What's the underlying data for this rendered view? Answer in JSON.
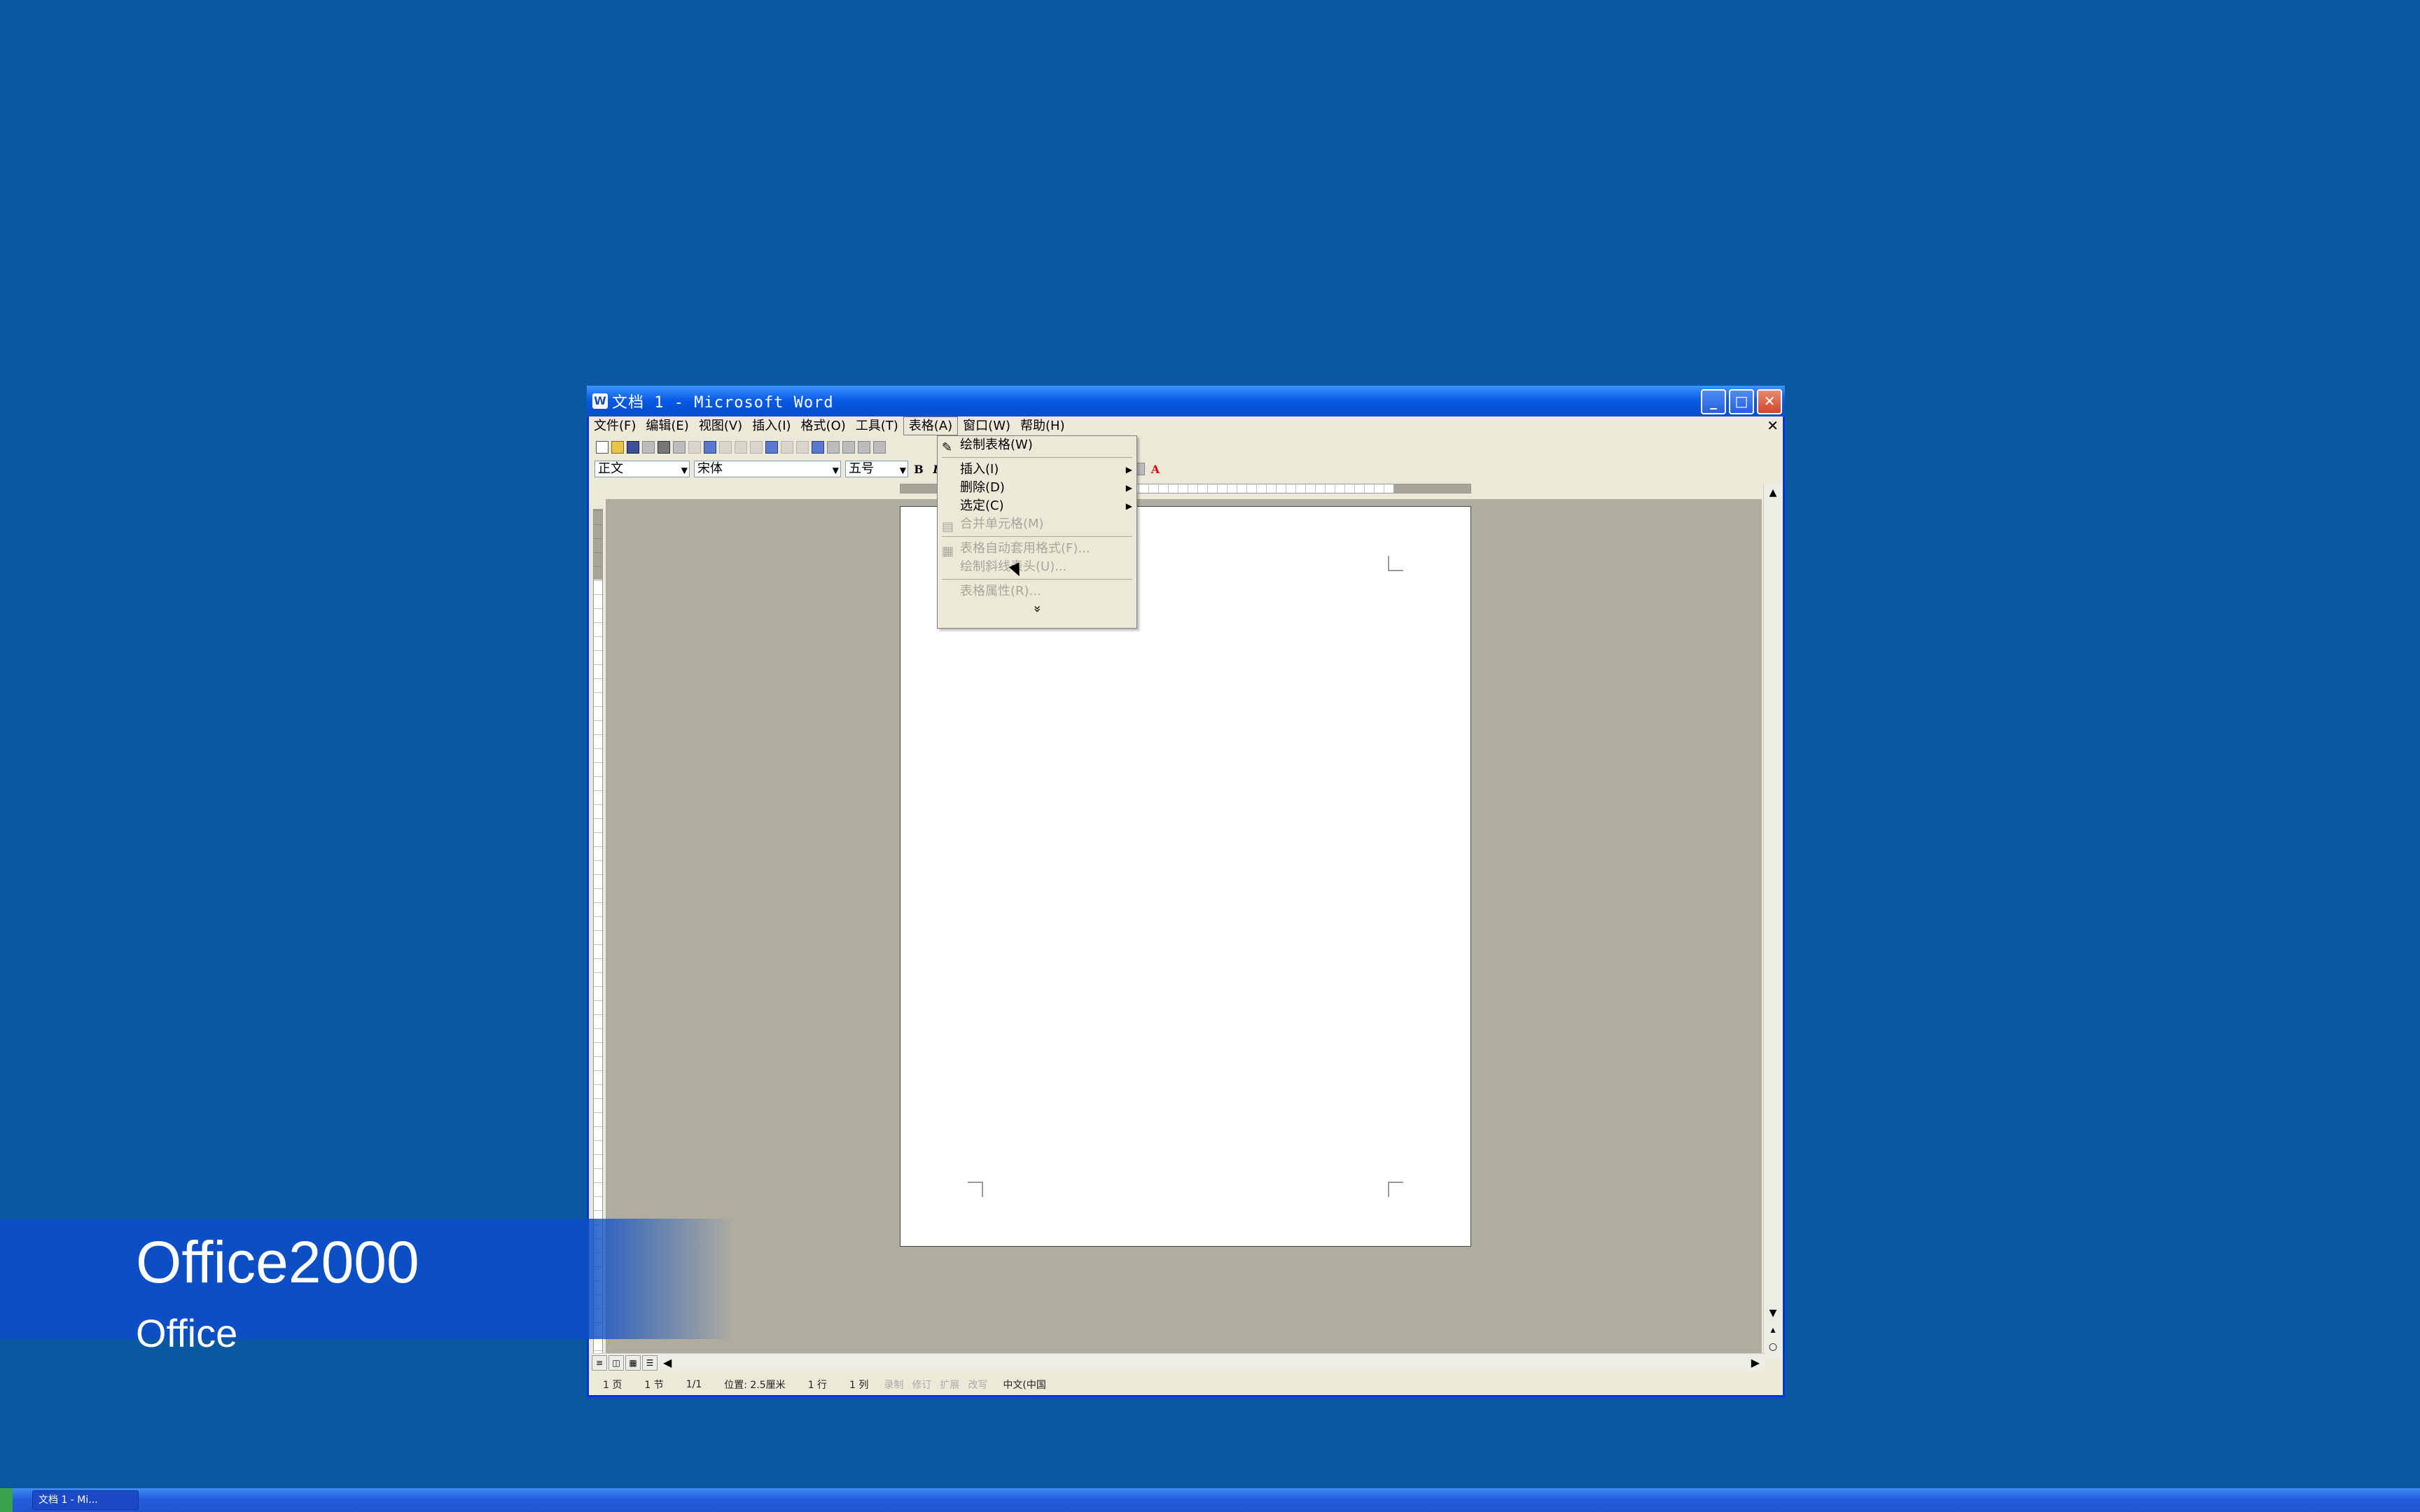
{
  "window": {
    "title": "文档 1 - Microsoft Word",
    "app_icon": "word-icon",
    "controls": {
      "minimize": "_",
      "maximize": "□",
      "close": "✕"
    }
  },
  "menubar": {
    "items": [
      {
        "label": "文件(F)"
      },
      {
        "label": "编辑(E)"
      },
      {
        "label": "视图(V)"
      },
      {
        "label": "插入(I)"
      },
      {
        "label": "格式(O)"
      },
      {
        "label": "工具(T)"
      },
      {
        "label": "表格(A)",
        "active": true
      },
      {
        "label": "窗口(W)"
      },
      {
        "label": "帮助(H)"
      }
    ],
    "doc_close": "✕"
  },
  "formatting": {
    "style": "正文",
    "font": "宋体",
    "size": "五号",
    "bold": "B",
    "italic": "I"
  },
  "table_menu": {
    "items": [
      {
        "label": "绘制表格(W)",
        "icon": "pencil-icon",
        "enabled": true
      },
      {
        "label": "插入(I)",
        "submenu": true,
        "enabled": true
      },
      {
        "label": "删除(D)",
        "submenu": true,
        "enabled": true
      },
      {
        "label": "选定(C)",
        "submenu": true,
        "enabled": true
      },
      {
        "label": "合并单元格(M)",
        "icon": "merge-icon",
        "enabled": false
      },
      {
        "label": "表格自动套用格式(F)...",
        "icon": "autoformat-icon",
        "enabled": false
      },
      {
        "label": "绘制斜线表头(U)...",
        "enabled": false
      },
      {
        "label": "表格属性(R)...",
        "enabled": false
      }
    ],
    "expand": "»"
  },
  "statusbar": {
    "page": "1 页",
    "section": "1 节",
    "page_of": "1/1",
    "position": "位置: 2.5厘米",
    "line": "1 行",
    "column": "1 列",
    "rec": "录制",
    "trk": "修订",
    "ext": "扩展",
    "ovr": "改写",
    "language": "中文(中国"
  },
  "caption": {
    "title": "Office2000",
    "subtitle": "Office"
  },
  "taskbar": {
    "task_label": "文档 1 - Mi..."
  },
  "colors": {
    "desktop": "#0a58a0",
    "caption_band": "#0c4ec8",
    "title_bar": "#0a5ce6",
    "doc_background": "#b0ad9e"
  }
}
